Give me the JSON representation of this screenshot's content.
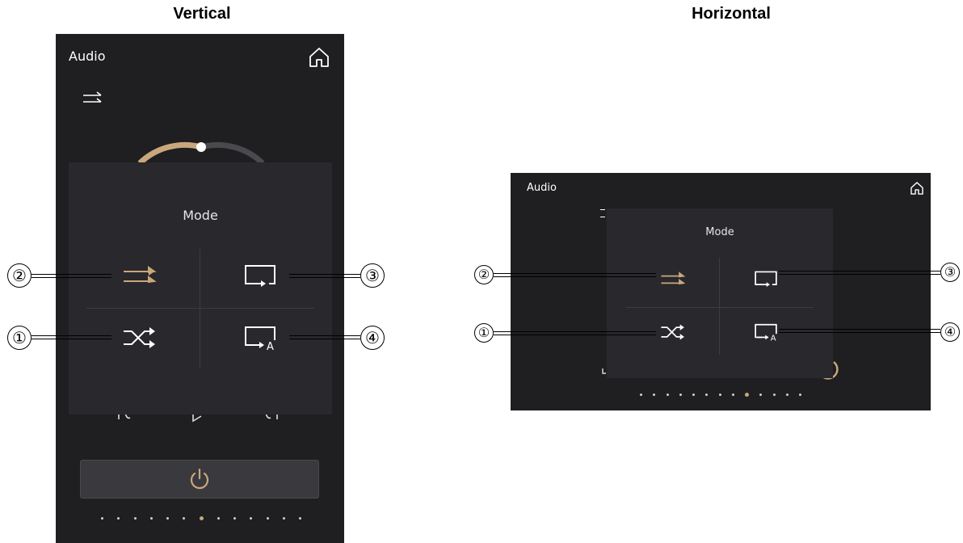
{
  "vertical": {
    "section_title": "Vertical",
    "app_title": "Audio",
    "mode_popup": {
      "title": "Mode",
      "options": [
        {
          "id": "sequential",
          "icon": "sequential-play-icon",
          "callout": "②",
          "active": true
        },
        {
          "id": "repeat-one",
          "icon": "repeat-current-icon",
          "callout": "③",
          "active": false
        },
        {
          "id": "shuffle",
          "icon": "shuffle-icon",
          "callout": "①",
          "active": false
        },
        {
          "id": "repeat-all",
          "icon": "repeat-all-icon",
          "callout": "④",
          "active": false
        }
      ],
      "repeat_all_letter": "A"
    },
    "page_dots": {
      "count": 13,
      "active_index": 6
    }
  },
  "horizontal": {
    "section_title": "Horizontal",
    "app_title": "Audio",
    "mode_popup": {
      "title": "Mode",
      "options": [
        {
          "id": "sequential",
          "icon": "sequential-play-icon",
          "callout": "②",
          "active": true
        },
        {
          "id": "repeat-one",
          "icon": "repeat-current-icon",
          "callout": "③",
          "active": false
        },
        {
          "id": "shuffle",
          "icon": "shuffle-icon",
          "callout": "①",
          "active": false
        },
        {
          "id": "repeat-all",
          "icon": "repeat-all-icon",
          "callout": "④",
          "active": false
        }
      ],
      "repeat_all_letter": "A"
    },
    "page_dots": {
      "count": 13,
      "active_index": 8
    }
  },
  "colors": {
    "panel_bg": "#1f1e21",
    "popup_bg": "#29282c",
    "accent_gold": "#c9a77c",
    "icon_white": "#ffffff"
  }
}
